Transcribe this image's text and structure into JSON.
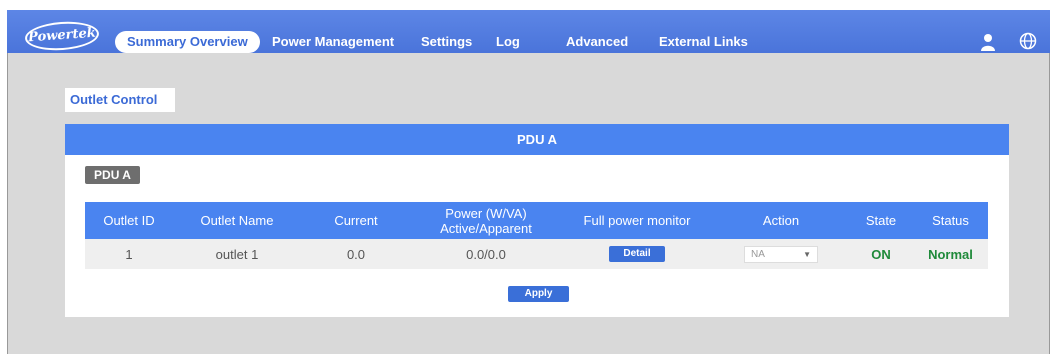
{
  "brand": {
    "logo_text": "Powertek"
  },
  "nav": {
    "items": [
      {
        "label": "Summary Overview",
        "active": true
      },
      {
        "label": "Power Management"
      },
      {
        "label": "Settings"
      },
      {
        "label": "Log"
      },
      {
        "label": "Advanced"
      },
      {
        "label": "External Links"
      }
    ]
  },
  "section": {
    "tab_label": "Outlet Control"
  },
  "panel": {
    "header": "PDU A",
    "badge": "PDU A",
    "table": {
      "columns": [
        "Outlet ID",
        "Outlet Name",
        "Current",
        "Power (W/VA)\nActive/Apparent",
        "Full power monitor",
        "Action",
        "State",
        "Status"
      ],
      "rows": [
        {
          "outlet_id": "1",
          "outlet_name": "outlet 1",
          "current": "0.0",
          "power": "0.0/0.0",
          "monitor_button": "Detail",
          "action_value": "NA",
          "state": "ON",
          "status": "Normal"
        }
      ]
    },
    "apply_label": "Apply"
  },
  "colors": {
    "nav_bg": "#4a74da",
    "accent": "#4a84f0",
    "status_ok": "#1f8a3a",
    "badge_bg": "#6e6e6e"
  }
}
